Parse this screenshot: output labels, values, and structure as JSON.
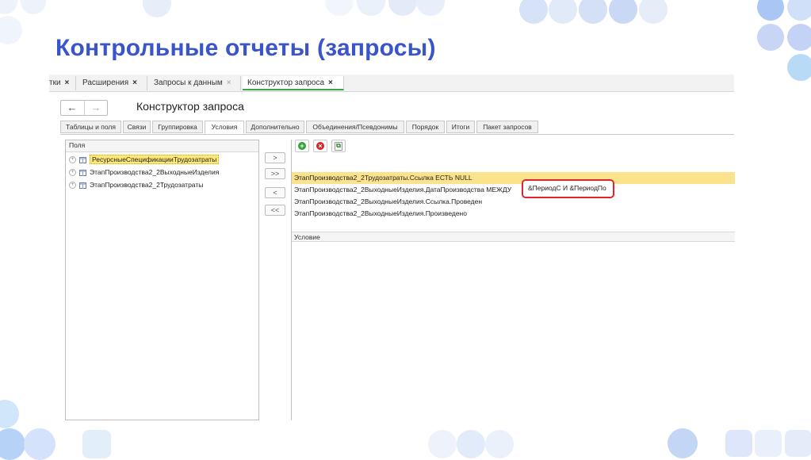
{
  "slide": {
    "title": "Контрольные отчеты (запросы)"
  },
  "doc_tabs": [
    {
      "label": "тки",
      "close": "×"
    },
    {
      "label": "Расширения",
      "close": "×"
    },
    {
      "label": "Запросы к данным",
      "close": "×"
    },
    {
      "label": "Конструктор запроса",
      "close": "×"
    }
  ],
  "nav": {
    "back": "←",
    "forward": "→"
  },
  "form": {
    "title": "Конструктор запроса"
  },
  "form_tabs": [
    "Таблицы и поля",
    "Связи",
    "Группировка",
    "Условия",
    "Дополнительно",
    "Объединения/Псевдонимы",
    "Порядок",
    "Итоги",
    "Пакет запросов"
  ],
  "active_form_tab": "Условия",
  "fields_panel": {
    "header": "Поля",
    "items": [
      {
        "label": "РесурсныеСпецификацииТрудозатраты"
      },
      {
        "label": "ЭтапПроизводства2_2ВыходныеИзделия"
      },
      {
        "label": "ЭтапПроизводства2_2Трудозатраты"
      }
    ]
  },
  "move_buttons": [
    ">",
    ">>",
    "<",
    "<<"
  ],
  "toolbar": {
    "add": "+",
    "delete": "×",
    "copy": "⧉"
  },
  "conditions": {
    "header": "Условие",
    "rows": [
      {
        "text": "ЭтапПроизводства2_2Трудозатраты.Ссылка ЕСТЬ NULL"
      },
      {
        "text": "ЭтапПроизводства2_2ВыходныеИзделия.ДатаПроизводства МЕЖДУ"
      },
      {
        "text": "ЭтапПроизводства2_2ВыходныеИзделия.Ссылка.Проведен"
      },
      {
        "text": "ЭтапПроизводства2_2ВыходныеИзделия.Произведено"
      }
    ],
    "highlight_text": "&ПериодС И &ПериодПо"
  },
  "colors": {
    "title": "#3a54c9",
    "highlight_border": "#e5232d",
    "selection": "#fbe38e",
    "active_tab_line": "#3fa447"
  }
}
